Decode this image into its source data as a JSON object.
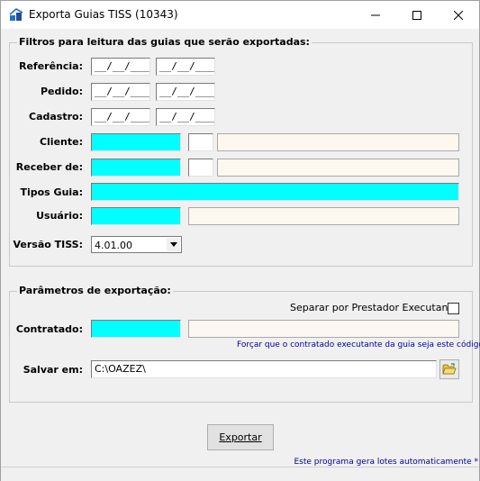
{
  "window": {
    "title": "Exporta Guias TISS (10343)"
  },
  "filters": {
    "group_title": "Filtros para leitura das guias que serão exportadas:",
    "referencia": {
      "label": "Referência:",
      "from": "__/__/____",
      "to": "__/__/____"
    },
    "pedido": {
      "label": "Pedido:",
      "from": "__/__/____",
      "to": "__/__/____"
    },
    "cadastro": {
      "label": "Cadastro:",
      "from": "__/__/____",
      "to": "__/__/____"
    },
    "cliente": {
      "label": "Cliente:",
      "code": "",
      "digit": "",
      "name": ""
    },
    "receber_de": {
      "label": "Receber de:",
      "code": "",
      "digit": "",
      "name": ""
    },
    "tipos_guia": {
      "label": "Tipos Guia:",
      "value": ""
    },
    "usuario": {
      "label": "Usuário:",
      "code": "",
      "name": ""
    },
    "versao_tiss": {
      "label": "Versão TISS:",
      "selected": "4.01.00"
    }
  },
  "export_params": {
    "group_title": "Parâmetros de exportação:",
    "separar_label": "Separar por Prestador Executante",
    "separar_checked": false,
    "contratado": {
      "label": "Contratado:",
      "code": "",
      "name": ""
    },
    "force_hint": "Forçar que o contratado executante da guia seja este código",
    "salvar_em": {
      "label": "Salvar em:",
      "value": "C:\\OAZEZ\\"
    }
  },
  "actions": {
    "export_label": "Exportar"
  },
  "footer": {
    "note": "Este programa gera lotes automaticamente *"
  },
  "icons": {
    "app": "app-icon",
    "minimize": "minimize-icon",
    "maximize": "maximize-icon",
    "close": "close-icon",
    "dropdown": "chevron-down-icon",
    "folder": "open-folder-icon"
  }
}
